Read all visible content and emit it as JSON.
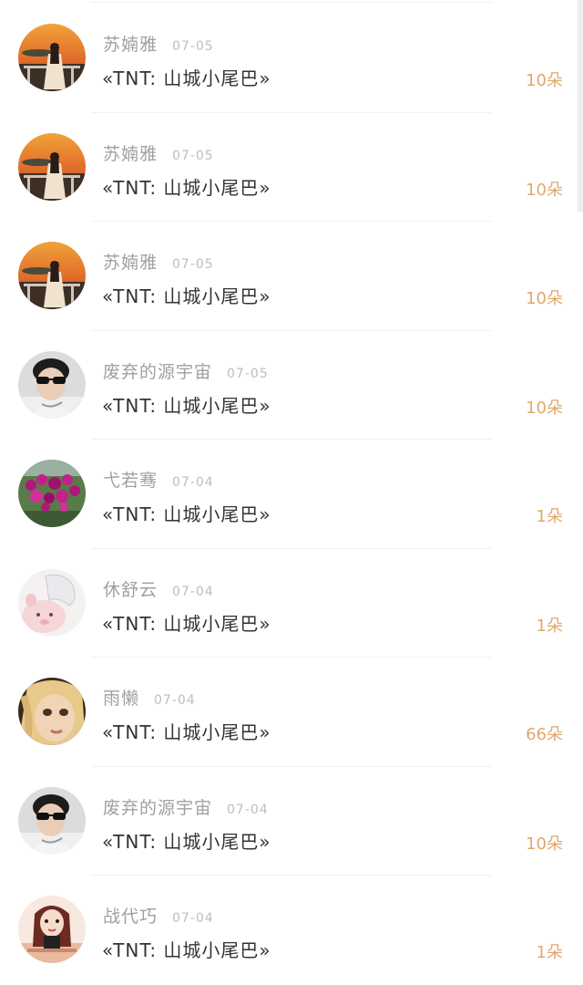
{
  "gift_list": {
    "rows": [
      {
        "username": "苏婻雅",
        "date": "07-05",
        "gift": "«TNT: 山城小尾巴»",
        "amount": "10朵",
        "avatar": "sunset-girl-avatar"
      },
      {
        "username": "苏婻雅",
        "date": "07-05",
        "gift": "«TNT: 山城小尾巴»",
        "amount": "10朵",
        "avatar": "sunset-girl-avatar"
      },
      {
        "username": "苏婻雅",
        "date": "07-05",
        "gift": "«TNT: 山城小尾巴»",
        "amount": "10朵",
        "avatar": "sunset-girl-avatar"
      },
      {
        "username": "废弃的源宇宙",
        "date": "07-05",
        "gift": "«TNT: 山城小尾巴»",
        "amount": "10朵",
        "avatar": "sunglasses-boy-avatar"
      },
      {
        "username": "弋若骞",
        "date": "07-04",
        "gift": "«TNT: 山城小尾巴»",
        "amount": "1朵",
        "avatar": "flowers-avatar"
      },
      {
        "username": "休舒云",
        "date": "07-04",
        "gift": "«TNT: 山城小尾巴»",
        "amount": "1朵",
        "avatar": "anime-pig-avatar"
      },
      {
        "username": "雨懒",
        "date": "07-04",
        "gift": "«TNT: 山城小尾巴»",
        "amount": "66朵",
        "avatar": "blonde-doll-avatar"
      },
      {
        "username": "废弃的源宇宙",
        "date": "07-04",
        "gift": "«TNT: 山城小尾巴»",
        "amount": "10朵",
        "avatar": "sunglasses-boy-avatar"
      },
      {
        "username": "战代巧",
        "date": "07-04",
        "gift": "«TNT: 山城小尾巴»",
        "amount": "1朵",
        "avatar": "cartoon-girl-avatar"
      }
    ]
  },
  "colors": {
    "username": "#a0a0a0",
    "date": "#bdbdbd",
    "gift_text": "#333333",
    "amount": "#e0a86c",
    "divider": "#f1f1f1"
  }
}
